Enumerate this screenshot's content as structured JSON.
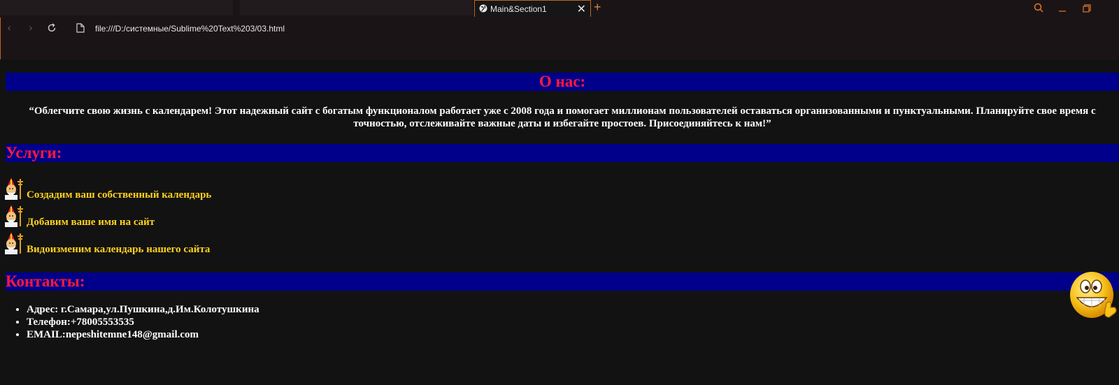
{
  "browser": {
    "active_tab_title": "Main&Section1",
    "close_glyph": "✕",
    "new_tab_glyph": "+",
    "url": "file:///D:/системные/Sublime%20Text%203/03.html"
  },
  "icons": {
    "back": "back-arrow-icon",
    "forward": "forward-arrow-icon",
    "reload": "reload-icon",
    "page": "page-icon",
    "search": "search-icon",
    "minimize": "minimize-icon",
    "restore": "restore-icon",
    "pope": "pope-emoji-icon",
    "smiley": "grinning-thumbs-up-smiley-icon"
  },
  "about": {
    "heading": "О нас:",
    "text": "“Облегчите свою жизнь с календарем! Этот надежный сайт с богатым функционалом работает уже с 2008 года и помогает миллионам пользователей оставаться организованными и пунктуальными. Планируйте свое время с точностью, отслеживайте важные даты и избегайте простоев. Присоединяйтесь к нам!”"
  },
  "services": {
    "heading": "Услуги:",
    "items": [
      "Создадим ваш собственный календарь",
      "Добавим ваше имя на сайт",
      "Видоизменим календарь нашего сайта"
    ]
  },
  "contacts": {
    "heading": "Контакты:",
    "items": [
      "Адрес: г.Самара,ул.Пушкина,д.Им.Колотушкина",
      "Телефон:+78005553535",
      "EMAIL:nepeshitemne148@gmail.com"
    ]
  },
  "colors": {
    "page_bg": "#121212",
    "header_bar": "#00008b",
    "header_text": "#ff1a3c",
    "service_text": "#ffd21f",
    "body_text": "#ffffff",
    "accent_border": "#c0651e"
  }
}
